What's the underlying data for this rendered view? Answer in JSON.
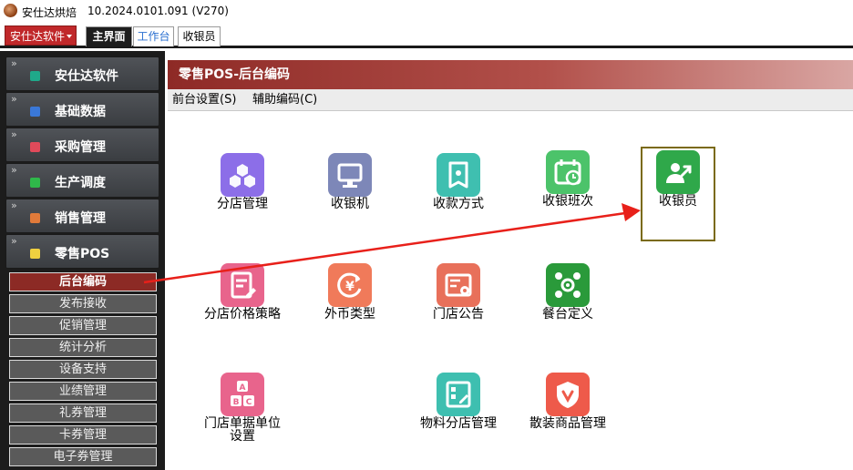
{
  "titlebar": {
    "app_name": "安仕达烘焙",
    "version": "10.2024.0101.091 (V270)"
  },
  "tabbar": {
    "brand_menu": "安仕达软件",
    "tabs": [
      {
        "label": "主界面"
      },
      {
        "label": "工作台"
      },
      {
        "label": "收银员"
      }
    ]
  },
  "sidebar": {
    "chevron": "»",
    "categories": [
      {
        "label": "安仕达软件",
        "icon": "software-icon",
        "color": "#1fa98a"
      },
      {
        "label": "基础数据",
        "icon": "basic-data-icon",
        "color": "#3a78d8"
      },
      {
        "label": "采购管理",
        "icon": "purchase-icon",
        "color": "#e04a5a"
      },
      {
        "label": "生产调度",
        "icon": "production-icon",
        "color": "#2fb84a"
      },
      {
        "label": "销售管理",
        "icon": "sales-icon",
        "color": "#e07a3a"
      },
      {
        "label": "零售POS",
        "icon": "retail-pos-icon",
        "color": "#f0d040"
      }
    ],
    "subitems": [
      {
        "label": "后台编码",
        "active": true
      },
      {
        "label": "发布接收",
        "active": false
      },
      {
        "label": "促销管理",
        "active": false
      },
      {
        "label": "统计分析",
        "active": false
      },
      {
        "label": "设备支持",
        "active": false
      },
      {
        "label": "业绩管理",
        "active": false
      },
      {
        "label": "礼券管理",
        "active": false
      },
      {
        "label": "卡券管理",
        "active": false
      },
      {
        "label": "电子券管理",
        "active": false
      }
    ]
  },
  "panel": {
    "title": "零售POS-后台编码",
    "menus": [
      {
        "label": "前台设置(S)"
      },
      {
        "label": "辅助编码(C)"
      }
    ]
  },
  "tiles": [
    {
      "label": "分店管理",
      "icon": "store-icon",
      "color": "#8c6ee8"
    },
    {
      "label": "收银机",
      "icon": "monitor-icon",
      "color": "#7d87b8"
    },
    {
      "label": "收款方式",
      "icon": "payment-icon",
      "color": "#3fbfb0"
    },
    {
      "label": "收银班次",
      "icon": "shift-calendar-icon",
      "color": "#4cc36a"
    },
    {
      "label": "收银员",
      "icon": "cashier-icon",
      "color": "#2fa84a"
    },
    {
      "label": "分店价格策略",
      "icon": "price-strategy-icon",
      "color": "#e8648c"
    },
    {
      "label": "外币类型",
      "icon": "currency-icon",
      "color": "#f07a5a"
    },
    {
      "label": "门店公告",
      "icon": "announcement-icon",
      "color": "#e8705a"
    },
    {
      "label": "餐台定义",
      "icon": "table-def-icon",
      "color": "#2a9a3a"
    },
    {
      "label": "门店单据单位设置",
      "icon": "abc-units-icon",
      "color": "#e8648c"
    },
    {
      "label": "物料分店管理",
      "icon": "material-icon",
      "color": "#3ebfb0"
    },
    {
      "label": "散装商品管理",
      "icon": "bulk-goods-icon",
      "color": "#ee5a4a"
    }
  ],
  "annotation": {
    "arrow_color": "#e8201a",
    "highlight_color": "#7a6a10"
  }
}
